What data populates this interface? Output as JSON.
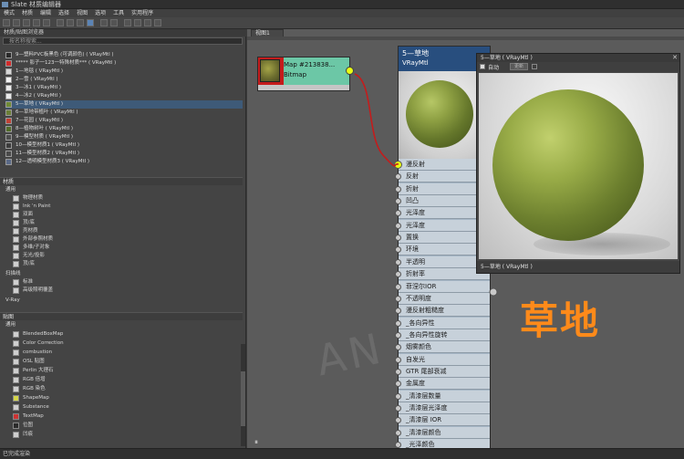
{
  "window": {
    "title": "Slate 材质编辑器"
  },
  "menubar": [
    "模式",
    "材质",
    "编辑",
    "选择",
    "视图",
    "选项",
    "工具",
    "实用程序"
  ],
  "browser": {
    "title": "材质/贴图浏览器",
    "search_placeholder": "按名称搜索...",
    "scene_materials": [
      {
        "label": "9—塑料PVC板黑色 (可调颜色)  ( VRayMtl )",
        "swatch": "#2a2a2a"
      },
      {
        "label": "***** 影子一123一特殊材质***  ( VRayMtl )",
        "swatch": "#d22b2b"
      },
      {
        "label": "1—地毯  ( VRayMtl )",
        "swatch": "#d8d8d8"
      },
      {
        "label": "2—雪  ( VRayMtl )",
        "swatch": "#f3f3f3"
      },
      {
        "label": "3—冰1  ( VRayMtl )",
        "swatch": "#ececec"
      },
      {
        "label": "4—冰2  ( VRayMtl )",
        "swatch": "#eaeaea"
      },
      {
        "label": "5—草地  ( VRayMtl )",
        "swatch": "#6f8b36"
      },
      {
        "label": "6—草地带植叶  ( VRayMtl )",
        "swatch": "#6b7f36"
      },
      {
        "label": "7—花园  ( VRayMtl )",
        "swatch": "#c04034"
      },
      {
        "label": "8—植物树叶  ( VRayMtl )",
        "swatch": "#526c2a"
      },
      {
        "label": "9—模型材质  ( VRayMtl )",
        "swatch": "#4d4d4d"
      },
      {
        "label": "10—模型材质1  ( VRayMtl )",
        "swatch": "#3c3c3c"
      },
      {
        "label": "11—模型材质2  ( VRayMtl )",
        "swatch": "#4a4a4a"
      },
      {
        "label": "12—透明模型材质3  ( VRayMtl )",
        "swatch": "#5a6a88"
      }
    ],
    "materials_section": "材质",
    "general_label": "通用",
    "general_items": [
      "物理材质",
      "Ink 'n Paint",
      "双面",
      "顶/底",
      "壳材质",
      "外部参照材质",
      "多维/子对象",
      "无光/投影",
      "顶/底"
    ],
    "scanline_label": "扫描线",
    "scanline_items": [
      "标准",
      "高级照明覆盖"
    ],
    "vray_label": "V-Ray",
    "maps_section": "贴图",
    "maps_general_label": "通用",
    "maps_items": [
      "BlendedBoxMap",
      "Color Correction",
      "combustion",
      "OSL 贴图",
      "Perlin 大理石",
      "RGB 倍增",
      "RGB 染色",
      "ShapeMap",
      "Substance",
      "TextMap",
      "位图",
      "凹痕"
    ]
  },
  "view": {
    "tab_label": "视图1",
    "map_node": {
      "line1": "Map #213838...",
      "line2": "Bitmap"
    },
    "material_node": {
      "name": "5—草地",
      "type": "VRayMtl",
      "slots": [
        "漫反射",
        "反射",
        "折射",
        "凹凸",
        "光泽度",
        "光泽度",
        "置换",
        "环境",
        "半透明",
        "折射率",
        "菲涅尔IOR",
        "不透明度",
        "漫反射粗糙度",
        "_各向异性",
        "_各向异性旋转",
        "烟雾颜色",
        "自发光",
        "GTR 尾部衰减",
        "金属度",
        "_清漆层数量",
        "_清漆层光泽度",
        "_清漆层 IOR",
        "_清漆层颜色",
        "_光泽颜色"
      ]
    }
  },
  "preview_window": {
    "title": "5—草地 ( VRayMtl )",
    "auto_label": "自动",
    "update_label": "更新",
    "footer": "5—草地  ( VRayMtl )"
  },
  "caption": "草地",
  "watermark": "AN 素材",
  "status_text": "已完成渲染",
  "colors": {
    "accent": "#ff8a1a",
    "node_header": "#284e7e",
    "socket_active": "#e8ff14",
    "wire": "#c41c1c"
  }
}
